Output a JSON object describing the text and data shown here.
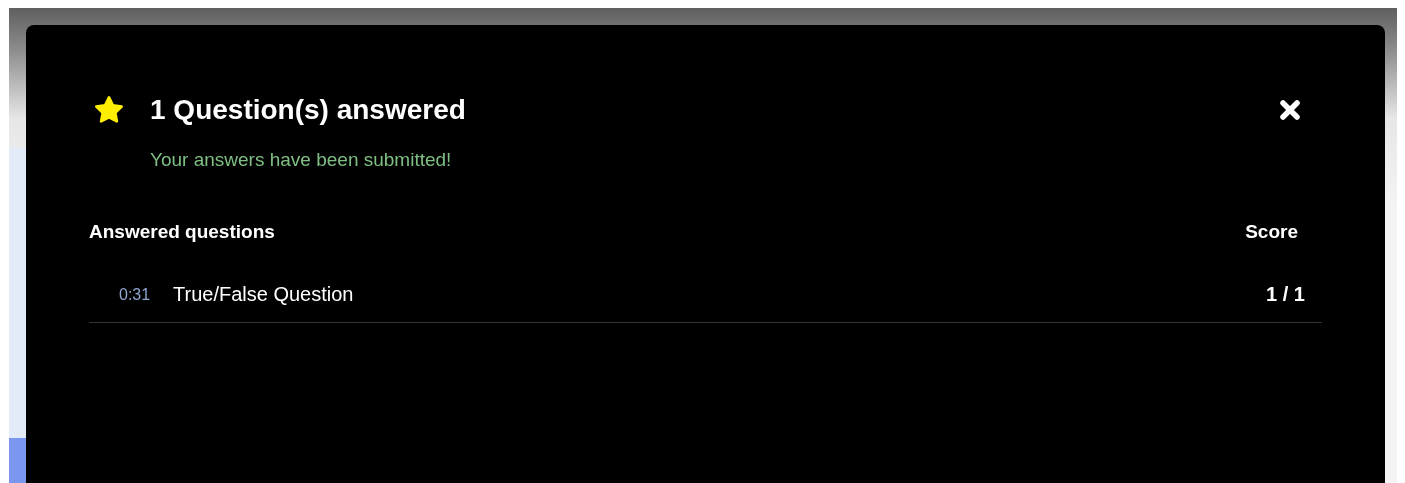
{
  "dialog": {
    "title": "1 Question(s) answered",
    "message": "Your answers have been submitted!",
    "table": {
      "columns": [
        "Answered questions",
        "Score"
      ],
      "rows": [
        {
          "time": "0:31",
          "question": "True/False Question",
          "score": "1 / 1"
        }
      ]
    }
  }
}
